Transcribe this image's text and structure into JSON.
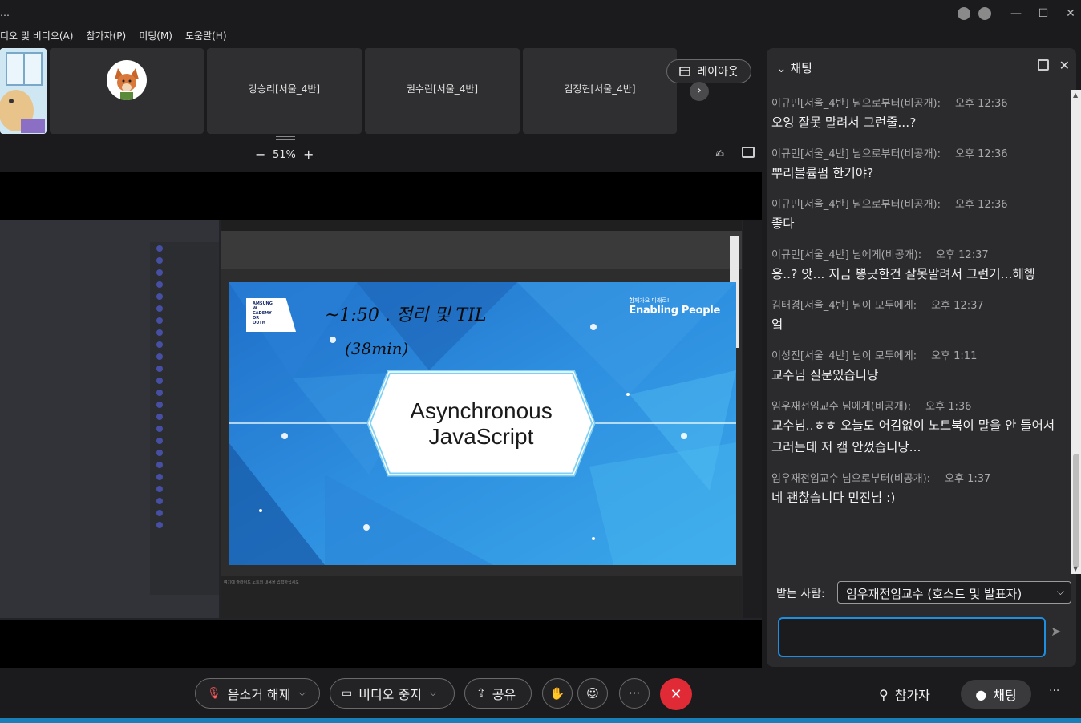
{
  "titlebar": {
    "hide_label": "…",
    "icons": [
      "shield-icon",
      "signal-icon"
    ],
    "win_min": "—",
    "win_max": "☐",
    "win_close": "✕"
  },
  "menu": [
    "디오 및 비디오(A)",
    "참가자(P)",
    "미팅(M)",
    "도움말(H)"
  ],
  "tiles": {
    "names": [
      "강승리[서울_4반]",
      "권수린[서울_4반]",
      "김정현[서울_4반]"
    ]
  },
  "layout_button": "레이아웃",
  "zoom": {
    "minus": "−",
    "value": "51%",
    "plus": "+"
  },
  "slide": {
    "logo_lines": [
      "AMSUNG",
      "W",
      "CADEMY",
      "OR",
      "OUTH"
    ],
    "tagline_small": "함께가요 미래로!",
    "tagline_big": "Enabling People",
    "handwriting_1": "~1:50 . 정리 및 TIL",
    "handwriting_2": "(38min)",
    "title_line1": "Asynchronous",
    "title_line2": "JavaScript"
  },
  "ppt": {
    "notes_placeholder": "여기에 슬라이드 노트의 내용을 입력하십시오"
  },
  "chat": {
    "title": "채팅",
    "messages": [
      {
        "sender": "이규민[서울_4반] 님으로부터(비공개):",
        "time": "오후 12:36",
        "text": "오잉 잘못 말려서 그런줄...?"
      },
      {
        "sender": "이규민[서울_4반] 님으로부터(비공개):",
        "time": "오후 12:36",
        "text": "뿌리볼륨펌 한거야?"
      },
      {
        "sender": "이규민[서울_4반] 님으로부터(비공개):",
        "time": "오후 12:36",
        "text": "좋다"
      },
      {
        "sender": "이규민[서울_4반] 님에게(비공개):",
        "time": "오후 12:37",
        "text": "응..? 앗... 지금 뽕긋한건 잘못말려서 그런거...헤헿"
      },
      {
        "sender": "김태경[서울_4반] 님이 모두에게:",
        "time": "오후 12:37",
        "text": "엌"
      },
      {
        "sender": "이성진[서울_4반] 님이 모두에게:",
        "time": "오후 1:11",
        "text": "교수님 질문있습니당"
      },
      {
        "sender": "임우재전임교수 님에게(비공개):",
        "time": "오후 1:36",
        "text": "교수님..ㅎㅎ 오늘도 어김없이 노트북이 말을 안 들어서 그러는데 저 캠 안껐습니당..."
      },
      {
        "sender": "임우재전임교수 님으로부터(비공개):",
        "time": "오후 1:37",
        "text": "네 괜찮습니다 민진님 :)"
      }
    ],
    "recipient_label": "받는 사람:",
    "recipient_value": "임우재전임교수 (호스트 및 발표자)",
    "input_value": ""
  },
  "bottombar": {
    "mute": "음소거 해제",
    "video": "비디오 중지",
    "share": "공유",
    "more": "···",
    "end": "✕",
    "participants": "참가자",
    "chat": "채팅",
    "more_right": "···"
  },
  "colors": {
    "accent": "#1e8ee0",
    "end": "#e02b36",
    "slide_blue": "#2a7fd4"
  }
}
